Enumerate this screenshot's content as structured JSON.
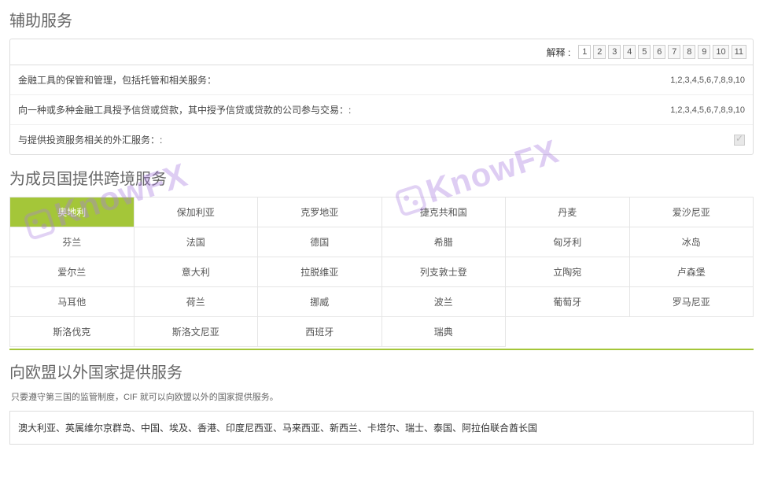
{
  "watermark": "KnowFX",
  "aux": {
    "title": "辅助服务",
    "pager_label": "解释 :",
    "pages": [
      "1",
      "2",
      "3",
      "4",
      "5",
      "6",
      "7",
      "8",
      "9",
      "10",
      "11"
    ],
    "rows": [
      {
        "label": "金融工具的保管和管理，包括托管和相关服务：",
        "value": "1,2,3,4,5,6,7,8,9,10"
      },
      {
        "label": "向一种或多种金融工具授予信贷或贷款，其中授予信贷或贷款的公司参与交易：:",
        "value": "1,2,3,4,5,6,7,8,9,10"
      },
      {
        "label": "与提供投资服务相关的外汇服务：:",
        "value": ""
      }
    ]
  },
  "cross": {
    "title": "为成员国提供跨境服务",
    "grid": [
      [
        "奥地利",
        "保加利亚",
        "克罗地亚",
        "捷克共和国",
        "丹麦",
        "爱沙尼亚"
      ],
      [
        "芬兰",
        "法国",
        "德国",
        "希腊",
        "匈牙利",
        "冰岛"
      ],
      [
        "爱尔兰",
        "意大利",
        "拉脱维亚",
        "列支敦士登",
        "立陶宛",
        "卢森堡"
      ],
      [
        "马耳他",
        "荷兰",
        "挪威",
        "波兰",
        "葡萄牙",
        "罗马尼亚"
      ],
      [
        "斯洛伐克",
        "斯洛文尼亚",
        "西班牙",
        "瑞典",
        "",
        ""
      ]
    ],
    "active": "奥地利"
  },
  "outside": {
    "title": "向欧盟以外国家提供服务",
    "desc": "只要遵守第三国的监管制度，CIF 就可以向欧盟以外的国家提供服务。",
    "list": "澳大利亚、英属维尔京群岛、中国、埃及、香港、印度尼西亚、马来西亚、新西兰、卡塔尔、瑞士、泰国、阿拉伯联合酋长国"
  }
}
